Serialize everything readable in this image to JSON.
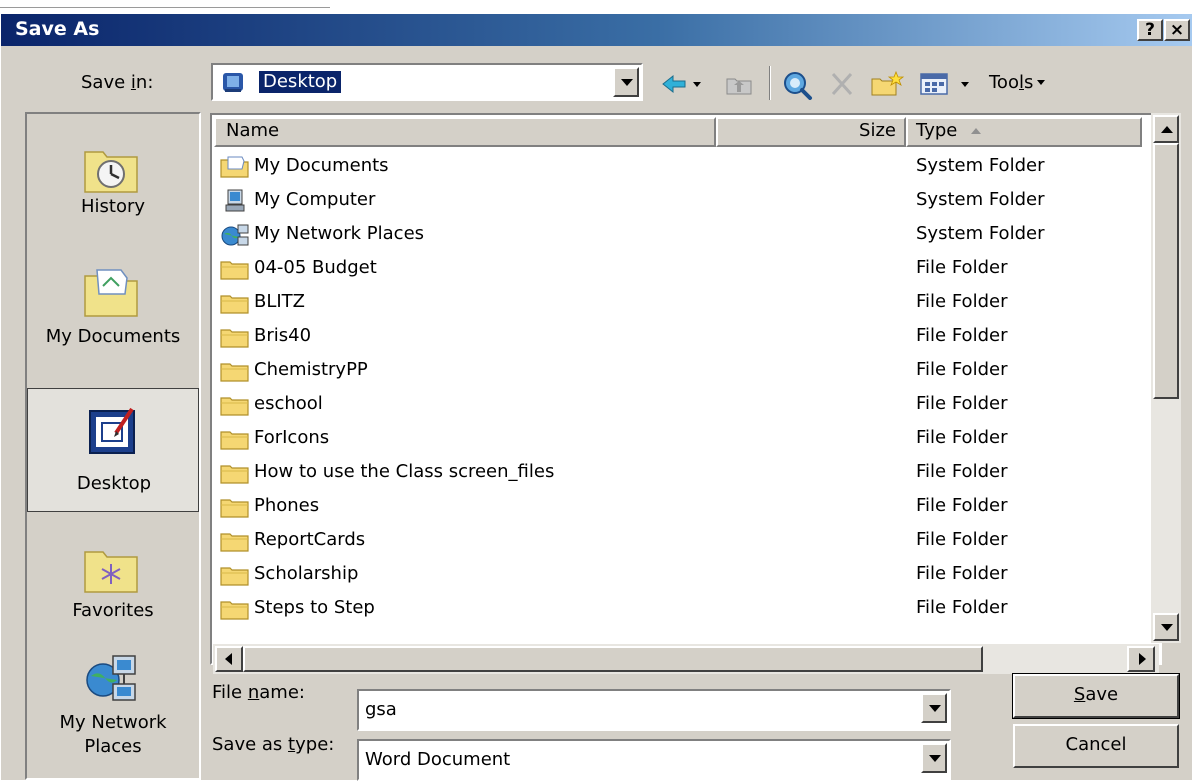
{
  "window": {
    "title": "Save As",
    "help_label": "?",
    "close_label": "×"
  },
  "save_in": {
    "label_pre": "Save ",
    "label_ul": "i",
    "label_post": "n:",
    "value": "Desktop"
  },
  "toolbar": {
    "tools_pre": "Too",
    "tools_ul": "l",
    "tools_post": "s",
    "icons": [
      "back-icon",
      "up-folder-icon",
      "search-web-icon",
      "delete-icon",
      "new-folder-icon",
      "views-icon"
    ]
  },
  "places": [
    {
      "label": "History",
      "icon": "history-icon",
      "active": false
    },
    {
      "label": "My Documents",
      "icon": "my-documents-icon",
      "active": false
    },
    {
      "label": "Desktop",
      "icon": "desktop-icon",
      "active": true
    },
    {
      "label": "Favorites",
      "icon": "favorites-icon",
      "active": false
    },
    {
      "label_line1": "My Network",
      "label_line2": "Places",
      "icon": "network-places-icon",
      "active": false
    }
  ],
  "file_list": {
    "columns": {
      "name": "Name",
      "size": "Size",
      "type": "Type"
    },
    "rows": [
      {
        "name": "My Documents",
        "type": "System Folder",
        "icon": "my-documents-icon"
      },
      {
        "name": "My Computer",
        "type": "System Folder",
        "icon": "my-computer-icon"
      },
      {
        "name": "My Network Places",
        "type": "System Folder",
        "icon": "network-places-icon"
      },
      {
        "name": "04-05 Budget",
        "type": "File Folder",
        "icon": "folder-icon"
      },
      {
        "name": "BLITZ",
        "type": "File Folder",
        "icon": "folder-icon"
      },
      {
        "name": "Bris40",
        "type": "File Folder",
        "icon": "folder-icon"
      },
      {
        "name": "ChemistryPP",
        "type": "File Folder",
        "icon": "folder-icon"
      },
      {
        "name": "eschool",
        "type": "File Folder",
        "icon": "folder-icon"
      },
      {
        "name": "ForIcons",
        "type": "File Folder",
        "icon": "folder-icon"
      },
      {
        "name": "How to use the Class screen_files",
        "type": "File Folder",
        "icon": "folder-icon"
      },
      {
        "name": "Phones",
        "type": "File Folder",
        "icon": "folder-icon"
      },
      {
        "name": "ReportCards",
        "type": "File Folder",
        "icon": "folder-icon"
      },
      {
        "name": "Scholarship",
        "type": "File Folder",
        "icon": "folder-icon"
      },
      {
        "name": "Steps to Step",
        "type": "File Folder",
        "icon": "folder-icon"
      }
    ]
  },
  "file_name": {
    "label_pre": "File ",
    "label_ul": "n",
    "label_post": "ame:",
    "value": "gsa"
  },
  "save_as_type": {
    "label_pre": "Save as ",
    "label_ul": "t",
    "label_post": "ype:",
    "value": "Word Document"
  },
  "buttons": {
    "save_ul": "S",
    "save_rest": "ave",
    "cancel": "Cancel"
  },
  "colors": {
    "title_start": "#0a246a",
    "title_end": "#a6caf0",
    "face": "#d4d0c8",
    "selection": "#0a246a",
    "folder": "#f5d773"
  }
}
